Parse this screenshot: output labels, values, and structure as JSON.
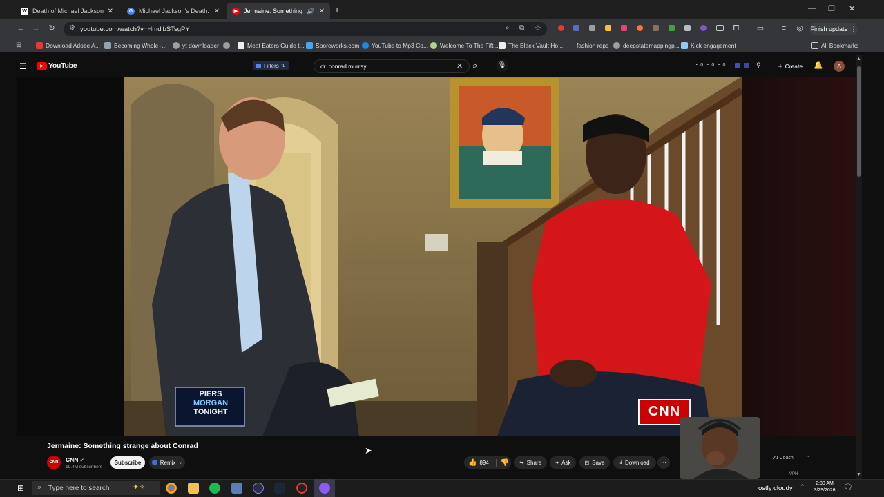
{
  "browser": {
    "tabs": [
      {
        "title": "Death of Michael Jackson - Wi",
        "favicon": "W"
      },
      {
        "title": "Michael Jackson's Death: Prop",
        "favicon": "G"
      },
      {
        "title": "Jermaine: Something strang",
        "favicon": "▶"
      }
    ],
    "url": "youtube.com/watch?v=HmdlbSTsgPY",
    "finish_update": "Finish update",
    "bookmarks": [
      "Download Adobe A...",
      "Becoming Whole -...",
      "yt downloader",
      "Meat Eaters Guide t...",
      "Sporeworks.com",
      "YouTube to Mp3 Co...",
      "Welcome To The Fift...",
      "The Black Vault Ho...",
      "fashion reps",
      "deepstatemappingp...",
      "Kick engagement"
    ],
    "all_bookmarks": "All Bookmarks"
  },
  "youtube": {
    "logo_text": "YouTube",
    "filters_label": "Filters",
    "search_query": "dr. conrad murray",
    "header_counts": [
      "0",
      "0",
      "0"
    ],
    "create_label": "Create",
    "avatar_letter": "A"
  },
  "video": {
    "show_logo_line1": "PIERS",
    "show_logo_line2": "MORGAN",
    "show_logo_line3": "TONIGHT",
    "network_bug": "CNN",
    "title": "Jermaine: Something strange about Conrad",
    "channel_name": "CNN",
    "channel_avatar": "CNN",
    "subscribers": "19.4M subscribers",
    "subscribe_label": "Subscribe",
    "remix_label": "Remix",
    "likes": "894",
    "share_label": "Share",
    "ask_label": "Ask",
    "save_label": "Save",
    "download_label": "Download",
    "ai_coach_label": "AI Coach",
    "view_label": "view",
    "vph_label": "VPH"
  },
  "taskbar": {
    "search_placeholder": "Type here to search",
    "weather": "ostly cloudy",
    "time": "2:30 AM",
    "date": "3/29/2026"
  },
  "colors": {
    "youtube_red": "#ff0000",
    "cnn_red": "#cc0000",
    "shirt_red": "#d4161a"
  }
}
